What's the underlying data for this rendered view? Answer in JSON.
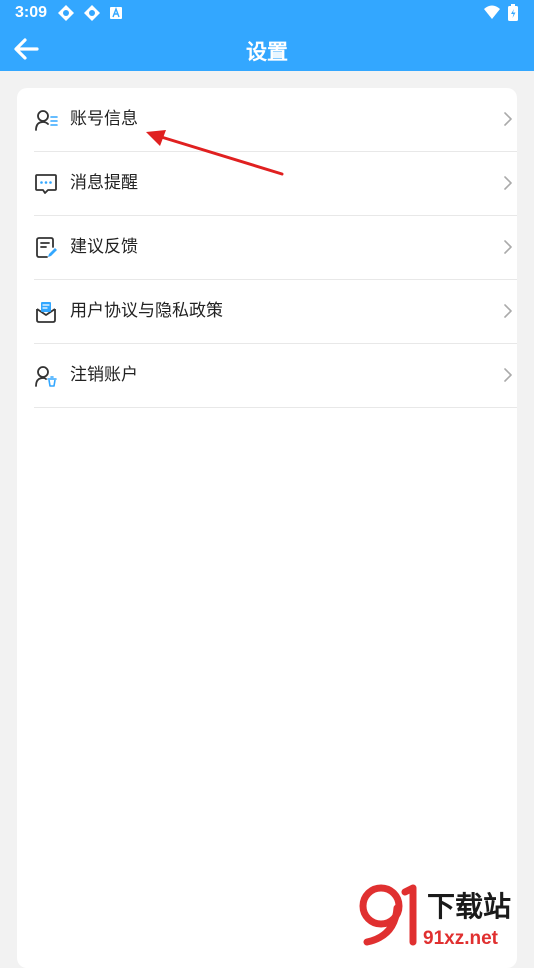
{
  "status_bar": {
    "time": "3:09"
  },
  "header": {
    "title": "设置"
  },
  "menu": {
    "items": [
      {
        "label": "账号信息",
        "icon": "account-info-icon"
      },
      {
        "label": "消息提醒",
        "icon": "message-icon"
      },
      {
        "label": "建议反馈",
        "icon": "feedback-icon"
      },
      {
        "label": "用户协议与隐私政策",
        "icon": "privacy-policy-icon"
      },
      {
        "label": "注销账户",
        "icon": "delete-account-icon"
      }
    ]
  },
  "watermark": {
    "brand": "下载站",
    "domain": "91xz.net"
  },
  "colors": {
    "accent": "#33a7ff",
    "background": "#f2f2f2",
    "annotation_arrow": "#e02020"
  }
}
